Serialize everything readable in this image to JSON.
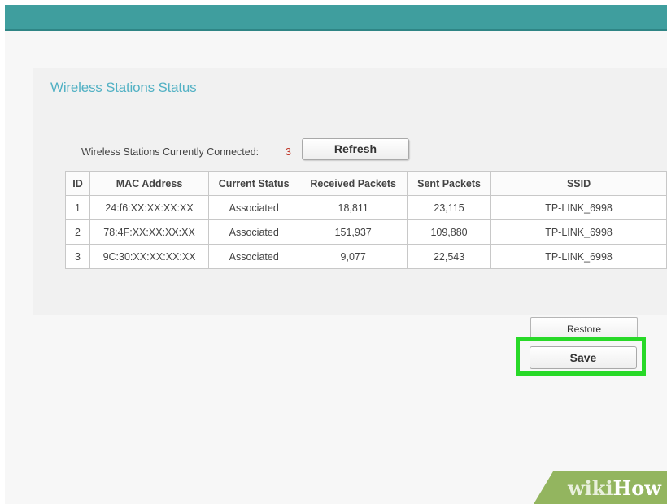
{
  "panel": {
    "title": "Wireless Stations Status"
  },
  "connected": {
    "label": "Wireless Stations Currently Connected:",
    "count": "3",
    "refresh_label": "Refresh"
  },
  "table": {
    "headers": [
      "ID",
      "MAC Address",
      "Current Status",
      "Received Packets",
      "Sent Packets",
      "SSID"
    ],
    "rows": [
      [
        "1",
        "24:f6:XX:XX:XX:XX",
        "Associated",
        "18,811",
        "23,115",
        "TP-LINK_6998"
      ],
      [
        "2",
        "78:4F:XX:XX:XX:XX",
        "Associated",
        "151,937",
        "109,880",
        "TP-LINK_6998"
      ],
      [
        "3",
        "9C:30:XX:XX:XX:XX",
        "Associated",
        "9,077",
        "22,543",
        "TP-LINK_6998"
      ]
    ]
  },
  "buttons": {
    "restore_label": "Restore",
    "save_label": "Save"
  },
  "watermark": {
    "part1": "wiki",
    "part2": "How"
  },
  "colors": {
    "top_bar": "#3f9e9e",
    "title": "#52b1c4",
    "connected_count": "#c0392b",
    "highlight": "#28d928",
    "watermark_band": "#93b55f"
  }
}
